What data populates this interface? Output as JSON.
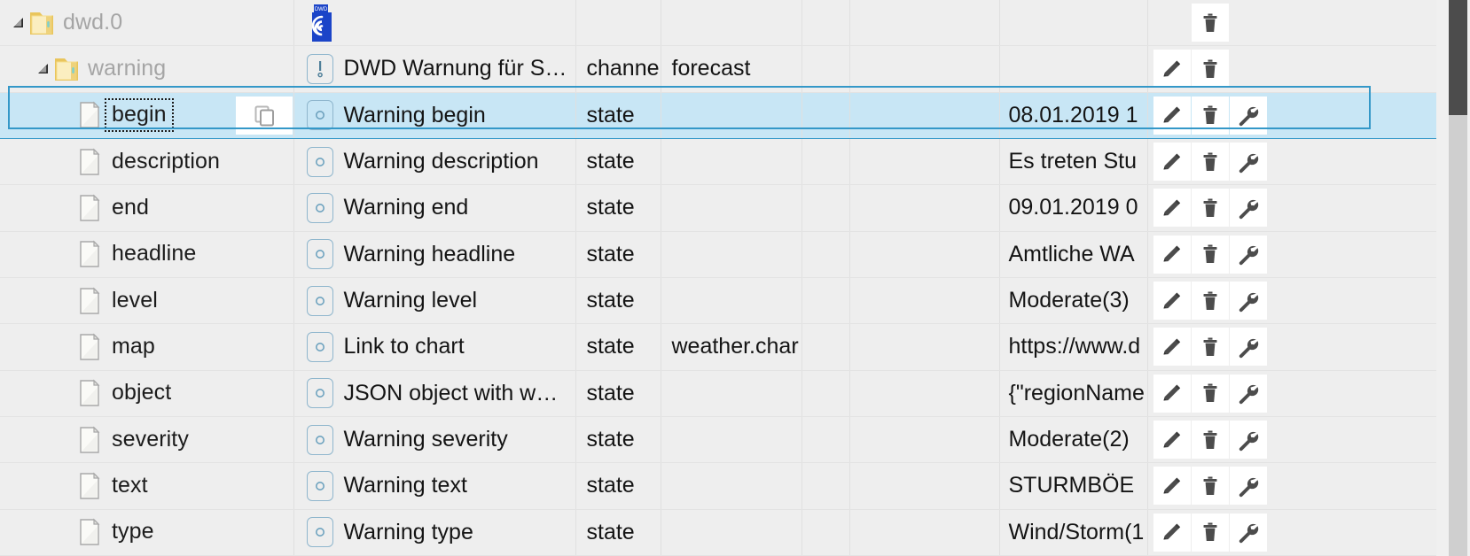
{
  "tree": {
    "rows": [
      {
        "name": "dwd.0",
        "kind": "folder",
        "indent": 1,
        "expanded": true,
        "icon": "folder-icon",
        "title": "",
        "title_icon": "dwd-logo-icon",
        "role": "",
        "room": "",
        "func": "",
        "value": "",
        "selected": false,
        "actions": [
          "delete-icon"
        ]
      },
      {
        "name": "warning",
        "kind": "folder",
        "indent": 2,
        "expanded": true,
        "icon": "folder-icon",
        "title": "DWD Warnung für S…",
        "title_icon": "alert-state-icon",
        "role": "channe",
        "room": "forecast",
        "func": "",
        "value": "",
        "selected": false,
        "actions": [
          "edit-icon",
          "delete-icon"
        ]
      },
      {
        "name": "begin",
        "kind": "file",
        "indent": 3,
        "icon": "file-icon",
        "title": "Warning begin",
        "title_icon": "state-icon",
        "role": "state",
        "room": "",
        "func": "",
        "value": "08.01.2019 1",
        "selected": true,
        "focused": true,
        "copy_button": "copy-icon",
        "actions": [
          "edit-icon",
          "delete-icon",
          "settings-icon"
        ]
      },
      {
        "name": "description",
        "kind": "file",
        "indent": 3,
        "icon": "file-icon",
        "title": "Warning description",
        "title_icon": "state-icon",
        "role": "state",
        "room": "",
        "func": "",
        "value": "Es treten Stu",
        "selected": false,
        "actions": [
          "edit-icon",
          "delete-icon",
          "settings-icon"
        ]
      },
      {
        "name": "end",
        "kind": "file",
        "indent": 3,
        "icon": "file-icon",
        "title": "Warning end",
        "title_icon": "state-icon",
        "role": "state",
        "room": "",
        "func": "",
        "value": "09.01.2019 0",
        "selected": false,
        "actions": [
          "edit-icon",
          "delete-icon",
          "settings-icon"
        ]
      },
      {
        "name": "headline",
        "kind": "file",
        "indent": 3,
        "icon": "file-icon",
        "title": "Warning headline",
        "title_icon": "state-icon",
        "role": "state",
        "room": "",
        "func": "",
        "value": "Amtliche WA",
        "selected": false,
        "actions": [
          "edit-icon",
          "delete-icon",
          "settings-icon"
        ]
      },
      {
        "name": "level",
        "kind": "file",
        "indent": 3,
        "icon": "file-icon",
        "title": "Warning level",
        "title_icon": "state-icon",
        "role": "state",
        "room": "",
        "func": "",
        "value": "Moderate(3)",
        "selected": false,
        "actions": [
          "edit-icon",
          "delete-icon",
          "settings-icon"
        ]
      },
      {
        "name": "map",
        "kind": "file",
        "indent": 3,
        "icon": "file-icon",
        "title": "Link to chart",
        "title_icon": "state-icon",
        "role": "state",
        "room": "weather.char",
        "func": "",
        "value": "https://www.d",
        "selected": false,
        "actions": [
          "edit-icon",
          "delete-icon",
          "settings-icon"
        ]
      },
      {
        "name": "object",
        "kind": "file",
        "indent": 3,
        "icon": "file-icon",
        "title": "JSON object with w…",
        "title_icon": "state-icon",
        "role": "state",
        "room": "",
        "func": "",
        "value": "{\"regionName",
        "selected": false,
        "actions": [
          "edit-icon",
          "delete-icon",
          "settings-icon"
        ]
      },
      {
        "name": "severity",
        "kind": "file",
        "indent": 3,
        "icon": "file-icon",
        "title": "Warning severity",
        "title_icon": "state-icon",
        "role": "state",
        "room": "",
        "func": "",
        "value": "Moderate(2)",
        "selected": false,
        "actions": [
          "edit-icon",
          "delete-icon",
          "settings-icon"
        ]
      },
      {
        "name": "text",
        "kind": "file",
        "indent": 3,
        "icon": "file-icon",
        "title": "Warning text",
        "title_icon": "state-icon",
        "role": "state",
        "room": "",
        "func": "",
        "value": "STURMBÖE",
        "selected": false,
        "actions": [
          "edit-icon",
          "delete-icon",
          "settings-icon"
        ]
      },
      {
        "name": "type",
        "kind": "file",
        "indent": 3,
        "icon": "file-icon",
        "title": "Warning type",
        "title_icon": "state-icon",
        "role": "state",
        "room": "",
        "func": "",
        "value": "Wind/Storm(1",
        "selected": false,
        "actions": [
          "edit-icon",
          "delete-icon",
          "settings-icon"
        ]
      }
    ]
  },
  "scrollbar": {
    "name": "vertical-scrollbar",
    "thumb_top": 0,
    "thumb_height": 130
  },
  "colors": {
    "selection": "#c8e6f5",
    "selection_border": "#3498c8",
    "row_bg": "#eeeeee",
    "grid_line": "#e3e3e3",
    "text": "#141414",
    "muted_text": "#a5a5a5",
    "icon": "#4c4c4c",
    "folder": "#f2d377",
    "dwd_blue": "#1b44c8"
  }
}
